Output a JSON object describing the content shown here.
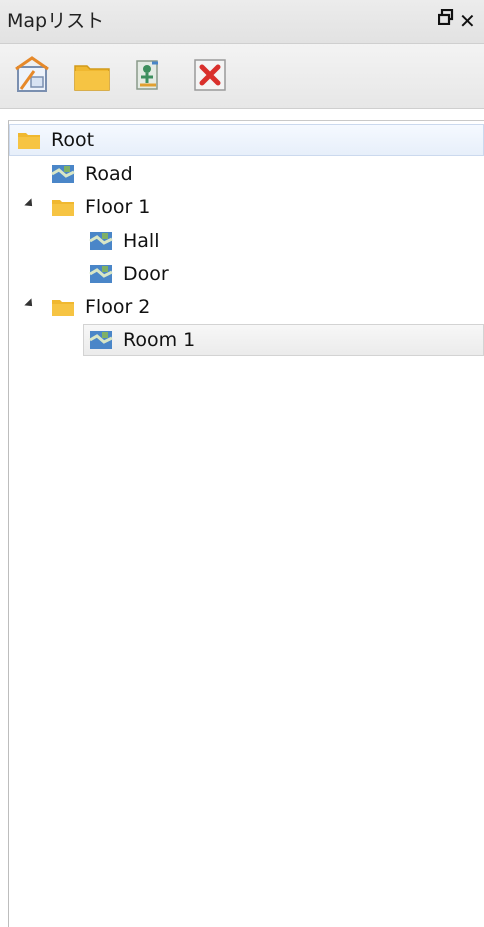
{
  "panel": {
    "title": "Mapリスト",
    "restore_icon": "restore-window-icon",
    "close_label": "✕"
  },
  "toolbar": {
    "buttons": [
      {
        "name": "new-map-button",
        "icon": "new-map-icon"
      },
      {
        "name": "new-folder-button",
        "icon": "folder-icon"
      },
      {
        "name": "import-map-button",
        "icon": "import-map-icon"
      },
      {
        "name": "delete-button",
        "icon": "delete-icon"
      }
    ]
  },
  "tree": {
    "root": {
      "label": "Root",
      "icon": "folder-icon",
      "selected": true
    },
    "items": [
      {
        "label": "Road",
        "icon": "map-icon"
      },
      {
        "label": "Floor 1",
        "icon": "folder-icon",
        "expanded": true
      },
      {
        "label": "Hall",
        "icon": "map-icon"
      },
      {
        "label": "Door",
        "icon": "map-icon"
      },
      {
        "label": "Floor 2",
        "icon": "folder-icon",
        "expanded": true
      },
      {
        "label": "Room 1",
        "icon": "map-icon",
        "highlighted": true
      }
    ]
  },
  "colors": {
    "folder": "#f0b830",
    "map": "#4a86c8",
    "delete": "#d9302c"
  }
}
